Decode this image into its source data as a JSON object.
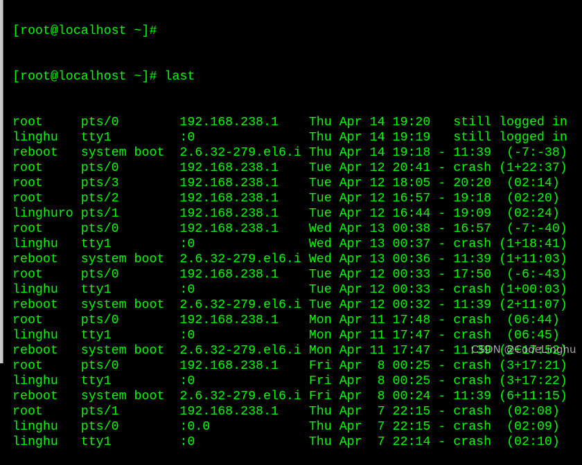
{
  "colors": {
    "background": "#000000",
    "text": "#00ff00",
    "border": "#c8c8c8"
  },
  "terminal": {
    "previous_prompt": "[root@localhost ~]#",
    "prompt": "[root@localhost ~]# last",
    "rows": [
      {
        "user": "root",
        "tty": "pts/0",
        "host": "192.168.238.1",
        "login": "Thu Apr 14 19:20",
        "logout": "still logged in",
        "duration": ""
      },
      {
        "user": "linghu",
        "tty": "tty1",
        "host": ":0",
        "login": "Thu Apr 14 19:19",
        "logout": "still logged in",
        "duration": ""
      },
      {
        "user": "reboot",
        "tty": "system boot",
        "host": "2.6.32-279.el6.i",
        "login": "Thu Apr 14 19:18",
        "logout": "11:39",
        "duration": "(-7:-38)"
      },
      {
        "user": "root",
        "tty": "pts/0",
        "host": "192.168.238.1",
        "login": "Tue Apr 12 20:41",
        "logout": "crash",
        "duration": "(1+22:37)"
      },
      {
        "user": "root",
        "tty": "pts/3",
        "host": "192.168.238.1",
        "login": "Tue Apr 12 18:05",
        "logout": "20:20",
        "duration": "(02:14)"
      },
      {
        "user": "root",
        "tty": "pts/2",
        "host": "192.168.238.1",
        "login": "Tue Apr 12 16:57",
        "logout": "19:18",
        "duration": "(02:20)"
      },
      {
        "user": "linghuro",
        "tty": "pts/1",
        "host": "192.168.238.1",
        "login": "Tue Apr 12 16:44",
        "logout": "19:09",
        "duration": "(02:24)"
      },
      {
        "user": "root",
        "tty": "pts/0",
        "host": "192.168.238.1",
        "login": "Wed Apr 13 00:38",
        "logout": "16:57",
        "duration": "(-7:-40)"
      },
      {
        "user": "linghu",
        "tty": "tty1",
        "host": ":0",
        "login": "Wed Apr 13 00:37",
        "logout": "crash",
        "duration": "(1+18:41)"
      },
      {
        "user": "reboot",
        "tty": "system boot",
        "host": "2.6.32-279.el6.i",
        "login": "Wed Apr 13 00:36",
        "logout": "11:39",
        "duration": "(1+11:03)"
      },
      {
        "user": "root",
        "tty": "pts/0",
        "host": "192.168.238.1",
        "login": "Tue Apr 12 00:33",
        "logout": "17:50",
        "duration": "(-6:-43)"
      },
      {
        "user": "linghu",
        "tty": "tty1",
        "host": ":0",
        "login": "Tue Apr 12 00:33",
        "logout": "crash",
        "duration": "(1+00:03)"
      },
      {
        "user": "reboot",
        "tty": "system boot",
        "host": "2.6.32-279.el6.i",
        "login": "Tue Apr 12 00:32",
        "logout": "11:39",
        "duration": "(2+11:07)"
      },
      {
        "user": "root",
        "tty": "pts/0",
        "host": "192.168.238.1",
        "login": "Mon Apr 11 17:48",
        "logout": "crash",
        "duration": "(06:44)"
      },
      {
        "user": "linghu",
        "tty": "tty1",
        "host": ":0",
        "login": "Mon Apr 11 17:47",
        "logout": "crash",
        "duration": "(06:45)"
      },
      {
        "user": "reboot",
        "tty": "system boot",
        "host": "2.6.32-279.el6.i",
        "login": "Mon Apr 11 17:47",
        "logout": "11:39",
        "duration": "(2+17:52)"
      },
      {
        "user": "root",
        "tty": "pts/0",
        "host": "192.168.238.1",
        "login": "Fri Apr  8 00:25",
        "logout": "crash",
        "duration": "(3+17:21)"
      },
      {
        "user": "linghu",
        "tty": "tty1",
        "host": ":0",
        "login": "Fri Apr  8 00:25",
        "logout": "crash",
        "duration": "(3+17:22)"
      },
      {
        "user": "reboot",
        "tty": "system boot",
        "host": "2.6.32-279.el6.i",
        "login": "Fri Apr  8 00:24",
        "logout": "11:39",
        "duration": "(6+11:15)"
      },
      {
        "user": "root",
        "tty": "pts/1",
        "host": "192.168.238.1",
        "login": "Thu Apr  7 22:15",
        "logout": "crash",
        "duration": "(02:08)"
      },
      {
        "user": "linghu",
        "tty": "pts/0",
        "host": ":0.0",
        "login": "Thu Apr  7 22:15",
        "logout": "crash",
        "duration": "(02:09)"
      },
      {
        "user": "linghu",
        "tty": "tty1",
        "host": ":0",
        "login": "Thu Apr  7 22:14",
        "logout": "crash",
        "duration": "(02:10)"
      }
    ]
  },
  "watermark": "CSDN @CodeLinghu"
}
